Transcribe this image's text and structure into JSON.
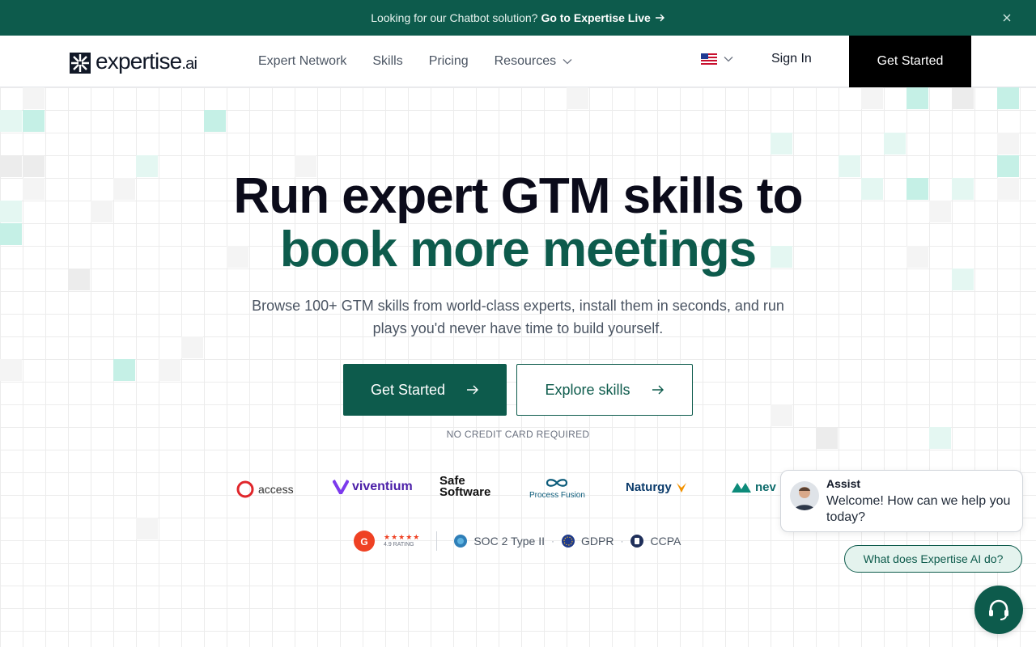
{
  "announcement": {
    "text": "Looking for our Chatbot solution?",
    "link": "Go to Expertise Live",
    "close_icon": "close-icon"
  },
  "header": {
    "logo_text": "expertise",
    "logo_suffix": ".ai",
    "nav": [
      {
        "label": "Expert Network"
      },
      {
        "label": "Skills"
      },
      {
        "label": "Pricing"
      },
      {
        "label": "Resources",
        "icon": "chevron-down-icon"
      }
    ],
    "language_icon": "us-flag-icon",
    "sign_in": "Sign In",
    "get_started": "Get Started"
  },
  "hero": {
    "headline_1": "Run expert GTM skills to",
    "headline_2": "book more meetings",
    "subheadline": "Browse 100+ GTM skills from world-class experts, install them in seconds, and run plays you'd never have time to build yourself.",
    "primary_cta": "Get Started",
    "secondary_cta": "Explore skills",
    "note": "NO CREDIT CARD REQUIRED"
  },
  "customers": [
    {
      "name": "access"
    },
    {
      "name": "viventium"
    },
    {
      "name_1": "Safe",
      "name_2": "Software"
    },
    {
      "name": "Process Fusion"
    },
    {
      "name": "Naturgy"
    },
    {
      "name": "nev"
    }
  ],
  "trust": {
    "stars": "★★★★★",
    "rating": "4.9 RATING",
    "badges": [
      "SOC 2 Type II",
      "GDPR",
      "CCPA"
    ]
  },
  "chat": {
    "name": "Assist",
    "message": "Welcome! How can we help you today?",
    "suggestion": "What does Expertise AI do?"
  },
  "colors": {
    "brand_green": "#0d5b4c",
    "accent_mint": "#c5f0e6",
    "text_dark": "#0b0b1a"
  }
}
